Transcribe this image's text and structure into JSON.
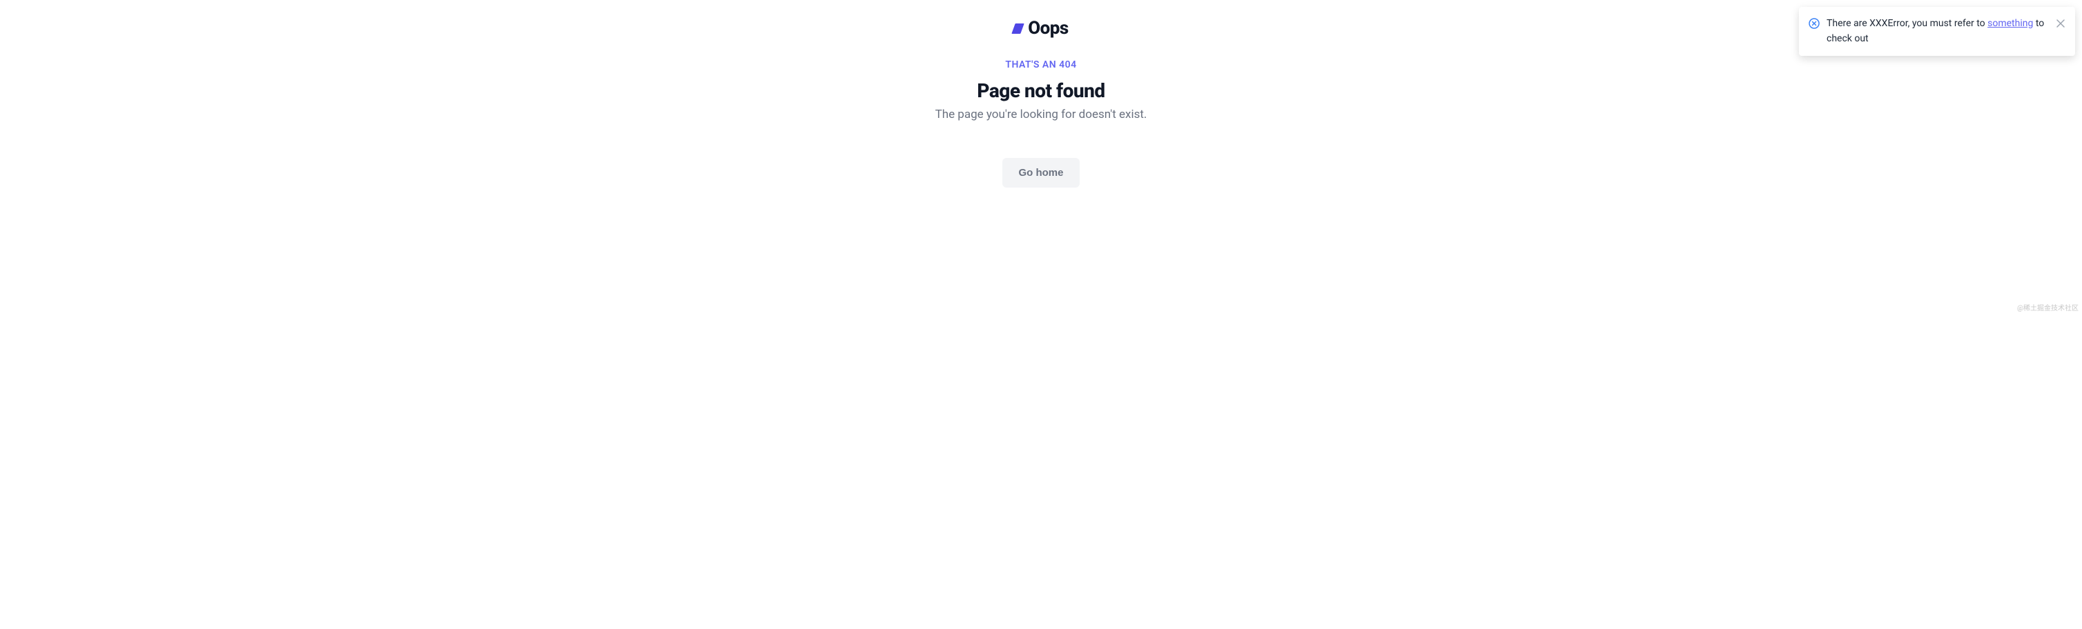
{
  "brand": {
    "title": "Oops"
  },
  "error": {
    "label": "THAT'S AN 404",
    "title": "Page not found",
    "subtitle": "The page you're looking for doesn't exist."
  },
  "button": {
    "go_home": "Go home"
  },
  "notification": {
    "text_before": "There are XXXError, you must refer to ",
    "link_text": "something",
    "text_after": " to check out"
  },
  "watermark": "@稀土掘金技术社区"
}
